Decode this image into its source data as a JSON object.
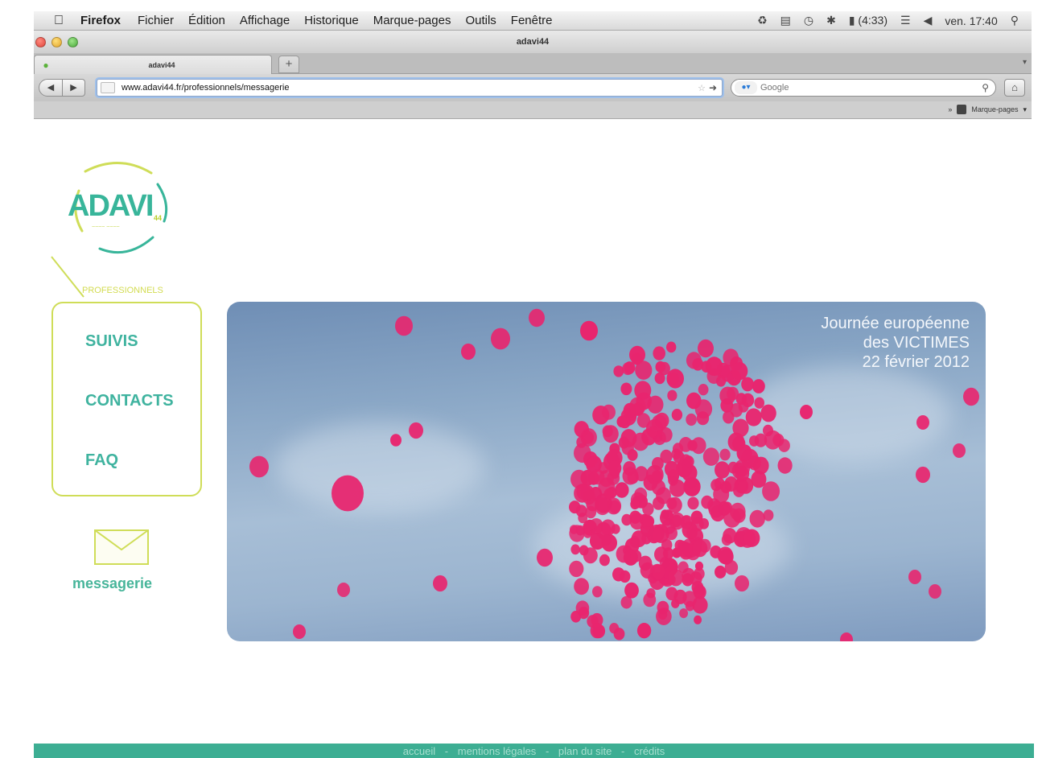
{
  "menubar": {
    "app_name": "Firefox",
    "menus": [
      "Fichier",
      "Édition",
      "Affichage",
      "Historique",
      "Marque-pages",
      "Outils",
      "Fenêtre"
    ],
    "battery": "(4:33)",
    "clock": "ven. 17:40"
  },
  "window": {
    "title": "adavi44"
  },
  "tab": {
    "label": "adavi44"
  },
  "navbar": {
    "url": "www.adavi44.fr/professionnels/messagerie",
    "search_placeholder": "Google"
  },
  "bookmarks": {
    "label": "Marque-pages"
  },
  "site": {
    "logo_text": "ADAVI",
    "logo_sub": "44",
    "nav_tab": "PROFESSIONNELS",
    "nav_items": [
      "SUIVIS",
      "CONTACTS",
      "FAQ"
    ],
    "mail_label": "messagerie",
    "banner_lines": [
      "Journée européenne",
      "des VICTIMES",
      "22 février 2012"
    ],
    "footer_links": [
      "accueil",
      "mentions légales",
      "plan du site",
      "crédits"
    ],
    "footer_sep": "-"
  },
  "colors": {
    "brand_teal": "#3fb39f",
    "brand_lime": "#cfdd58",
    "balloon_pink": "#e8256e",
    "footer_bg": "#3dae93"
  }
}
